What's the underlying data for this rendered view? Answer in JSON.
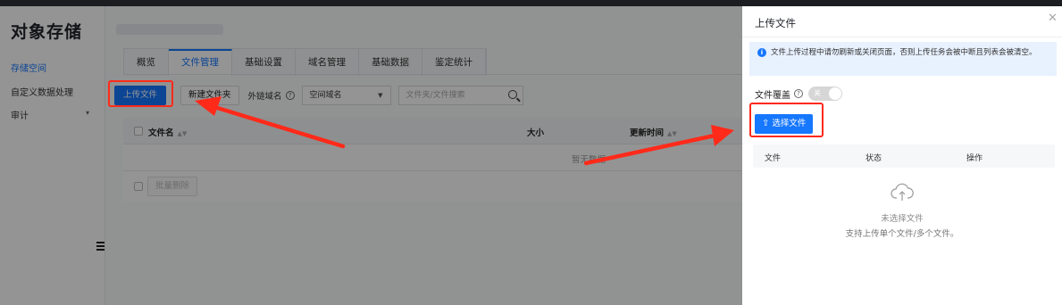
{
  "app": {
    "title": "对象存储",
    "sidebar": [
      {
        "label": "存储空间",
        "active": true
      },
      {
        "label": "自定义数据处理",
        "active": false
      },
      {
        "label": "审计",
        "active": false
      }
    ],
    "tabs": [
      {
        "label": "概览",
        "active": false
      },
      {
        "label": "文件管理",
        "active": true
      },
      {
        "label": "基础设置",
        "active": false
      },
      {
        "label": "域名管理",
        "active": false
      },
      {
        "label": "基础数据",
        "active": false
      },
      {
        "label": "鉴定统计",
        "active": false
      }
    ],
    "toolbar": {
      "upload_label": "上传文件",
      "new_folder_label": "新建文件夹",
      "link_domain_label": "外链域名",
      "domain_select_value": "空间域名",
      "search_placeholder": "文件夹/文件搜索"
    },
    "table": {
      "columns": [
        "文件名",
        "大小",
        "更新时间"
      ],
      "empty_text": "暂无数据",
      "batch_delete_label": "批量删除"
    }
  },
  "drawer": {
    "title": "上传文件",
    "alert_text": "文件上传过程中请勿刷新或关闭页面，否则上传任务会被中断且列表会被清空。",
    "override_label": "文件覆盖",
    "toggle_text": "关",
    "choose_button_label": "选择文件",
    "columns": [
      "文件",
      "状态",
      "操作"
    ],
    "empty_title": "未选择文件",
    "empty_subtitle": "支持上传单个文件/多个文件。"
  },
  "colors": {
    "primary": "#1677ff",
    "highlight": "#ff2a1a"
  }
}
